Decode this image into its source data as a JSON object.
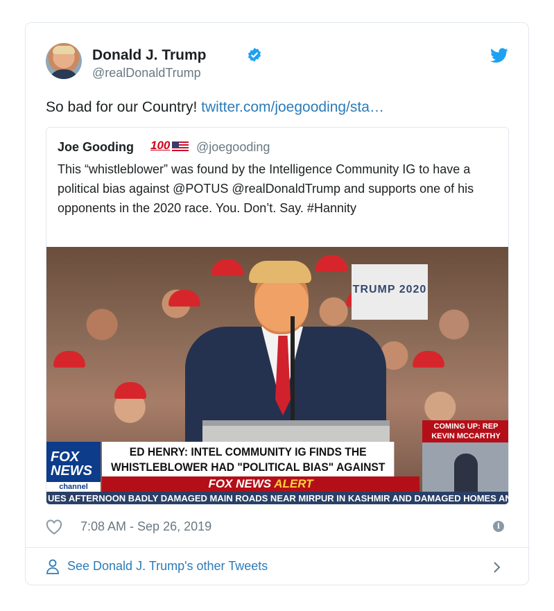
{
  "author": {
    "name": "Donald J. Trump",
    "handle": "@realDonaldTrump"
  },
  "tweet": {
    "text": "So bad for our Country!",
    "link_text": "twitter.com/joegooding/sta…"
  },
  "quoted": {
    "name": "Joe Gooding",
    "emoji": "100",
    "handle": "@joegooding",
    "text": "This “whistleblower” was found by the Intelligence Community IG to have a political bias against @POTUS @realDonaldTrump and supports one of his opponents in the 2020 race. You. Don’t. Say. #Hannity"
  },
  "media": {
    "sign_text": "TRUMP 2020",
    "fox_logo_line1": "FOX",
    "fox_logo_line2": "NEWS",
    "fox_logo_channel": "channel",
    "headline": "ED HENRY: INTEL COMMUNITY IG FINDS THE WHISTLEBLOWER HAD \"POLITICAL BIAS\" AGAINST TRUMP",
    "alert_brand": "FOX NEWS",
    "alert_word": "ALERT",
    "coming_up": "COMING UP: REP KEVIN MCCARTHY",
    "crawl": "UES AFTERNOON BADLY DAMAGED MAIN ROADS NEAR MIRPUR IN KASHMIR AND DAMAGED HOMES AND"
  },
  "meta": {
    "timestamp": "7:08 AM - Sep 26, 2019"
  },
  "footer": {
    "link_text": "See Donald J. Trump's other Tweets"
  },
  "colors": {
    "link": "#2b7bb9",
    "muted": "#697882",
    "border": "#e1e8ed",
    "verified": "#1da1f2"
  }
}
